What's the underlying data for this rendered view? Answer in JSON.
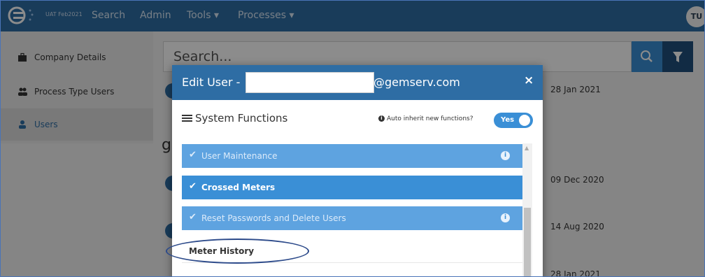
{
  "nav": {
    "env_label": "UAT Feb2021",
    "items": [
      "Search",
      "Admin",
      "Tools ▾",
      "Processes ▾"
    ],
    "avatar_initials": "TU"
  },
  "sidebar": {
    "items": [
      {
        "label": "Company Details",
        "icon": "briefcase-icon"
      },
      {
        "label": "Process Type Users",
        "icon": "users-icon"
      },
      {
        "label": "Users",
        "icon": "user-icon",
        "active": true
      }
    ]
  },
  "background": {
    "search_placeholder": "Search...",
    "dates": [
      "28 Jan 2021",
      "09 Dec 2020",
      "14 Aug 2020",
      "28 Jan 2021"
    ],
    "partial_heading": "g"
  },
  "modal": {
    "title_prefix": "Edit User -",
    "title_suffix": "@gemserv.com",
    "close_label": "×",
    "section_title": "System Functions",
    "auto_inherit_label": "Auto inherit new functions?",
    "toggle_label": "Yes",
    "functions": [
      {
        "label": "User Maintenance",
        "checked": true,
        "info": true
      },
      {
        "label": "Crossed Meters",
        "checked": true,
        "info": false
      },
      {
        "label": "Reset Passwords and Delete Users",
        "checked": true,
        "info": true
      },
      {
        "label": "Meter History",
        "checked": false,
        "info": false
      }
    ]
  },
  "colors": {
    "nav_bg": "#2e6da4",
    "accent": "#3a8fd6",
    "annotation": "#2c4a8a"
  }
}
